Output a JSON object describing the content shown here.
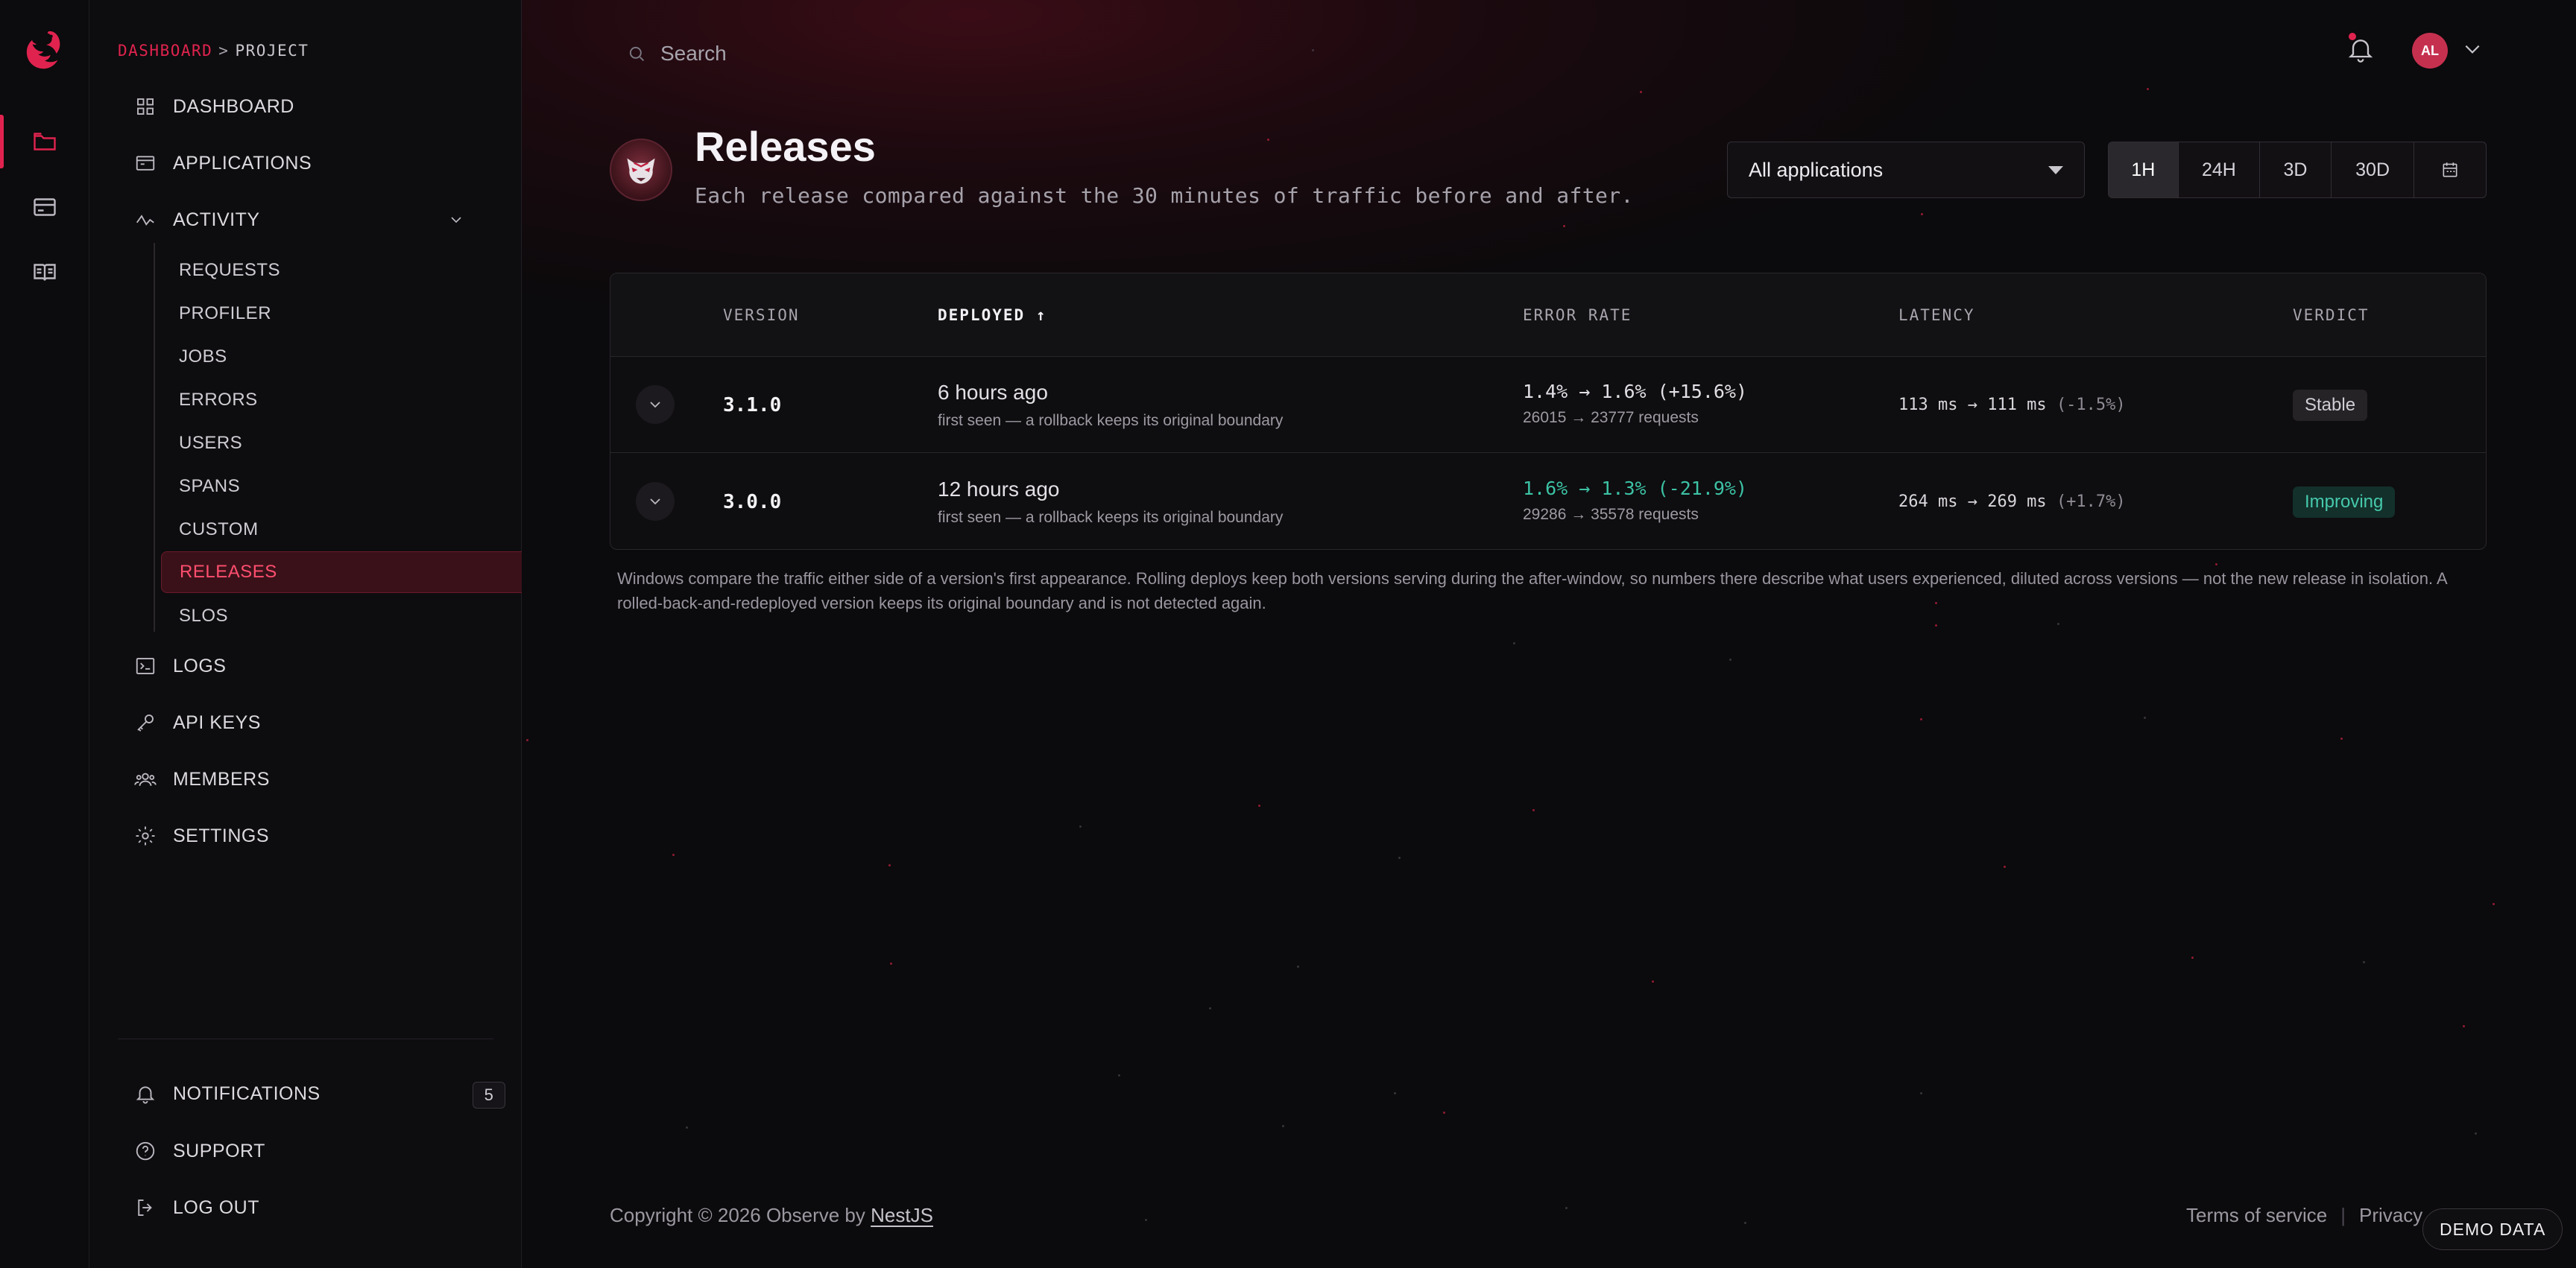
{
  "breadcrumb": {
    "root": "DASHBOARD",
    "separator": ">",
    "current": "PROJECT"
  },
  "nav": {
    "dashboard": "DASHBOARD",
    "applications": "APPLICATIONS",
    "activity": "ACTIVITY",
    "logs": "LOGS",
    "api_keys": "API KEYS",
    "members": "MEMBERS",
    "settings": "SETTINGS",
    "notifications": "NOTIFICATIONS",
    "notifications_count": "5",
    "support": "SUPPORT",
    "logout": "LOG OUT"
  },
  "activity_items": [
    "REQUESTS",
    "PROFILER",
    "JOBS",
    "ERRORS",
    "USERS",
    "SPANS",
    "CUSTOM",
    "RELEASES",
    "SLOS"
  ],
  "search": {
    "placeholder": "Search"
  },
  "user": {
    "initials": "AL"
  },
  "page": {
    "title": "Releases",
    "subtitle": "Each release compared against the 30 minutes of traffic before and after."
  },
  "filter": {
    "application": "All applications"
  },
  "ranges": [
    "1H",
    "24H",
    "3D",
    "30D"
  ],
  "selected_range": "1H",
  "table": {
    "headers": {
      "version": "VERSION",
      "deployed": "DEPLOYED",
      "deployed_sort": "↑",
      "error_rate": "ERROR RATE",
      "latency": "LATENCY",
      "verdict": "VERDICT"
    },
    "rows": [
      {
        "version": "3.1.0",
        "deployed": "6 hours ago",
        "deployed_note": "first seen — a rollback keeps its original boundary",
        "error_rate": "1.4% → 1.6% (+15.6%)",
        "requests": "26015 → 23777 requests",
        "latency": "113 ms → 111 ms",
        "latency_delta": "(-1.5%)",
        "verdict": "Stable"
      },
      {
        "version": "3.0.0",
        "deployed": "12 hours ago",
        "deployed_note": "first seen — a rollback keeps its original boundary",
        "error_rate": "1.6% → 1.3% (-21.9%)",
        "requests": "29286 → 35578 requests",
        "latency": "264 ms → 269 ms",
        "latency_delta": "(+1.7%)",
        "verdict": "Improving"
      }
    ]
  },
  "note": "Windows compare the traffic either side of a version's first appearance. Rolling deploys keep both versions serving during the after-window, so numbers there describe what users experienced, diluted across versions — not the new release in isolation. A rolled-back-and-redeployed version keeps its original boundary and is not detected again.",
  "footer": {
    "copyright": "Copyright © 2026 Observe by ",
    "brand_link": "NestJS",
    "terms": "Terms of service",
    "privacy": "Privacy",
    "separator": "|"
  },
  "demo_badge": "DEMO DATA",
  "colors": {
    "accent": "#e0234e",
    "good": "#3cc2a5",
    "background": "#0b0a0c"
  }
}
